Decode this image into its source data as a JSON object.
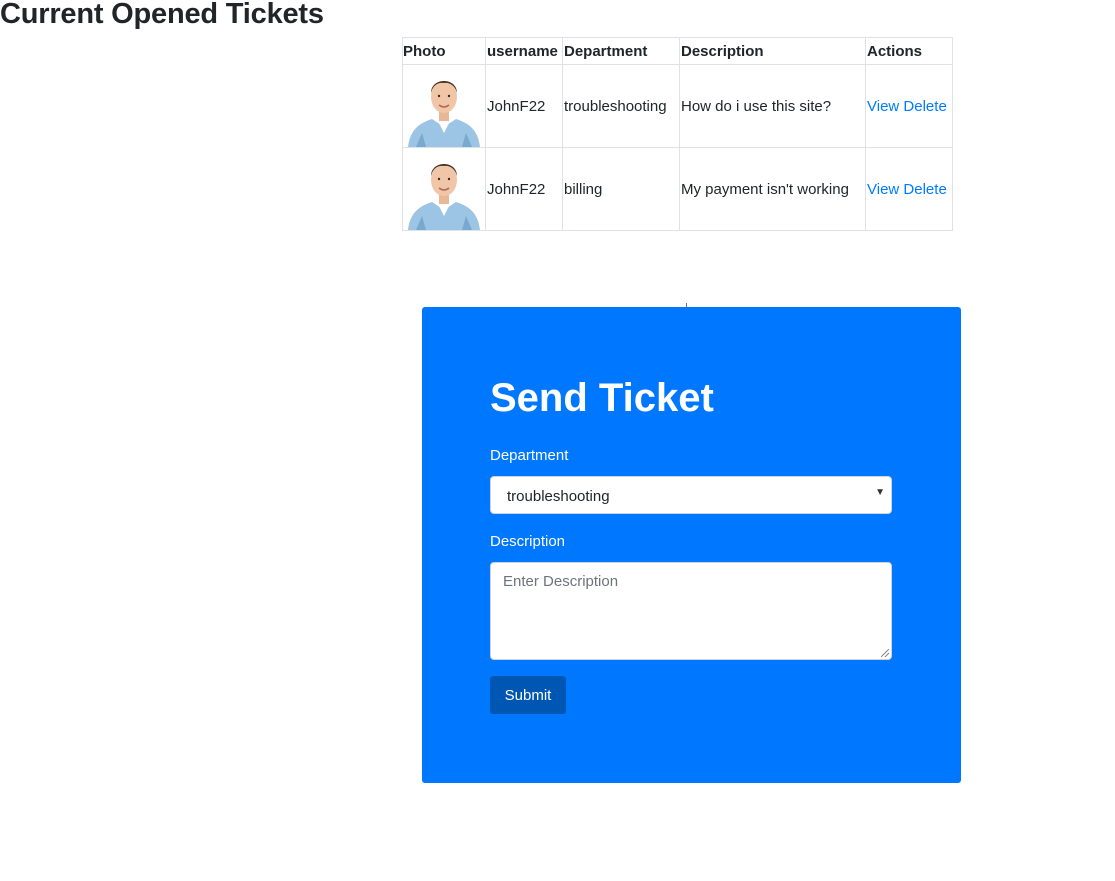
{
  "page": {
    "title": "Current Opened Tickets"
  },
  "table": {
    "headers": {
      "photo": "Photo",
      "username": "username",
      "department": "Department",
      "description": "Description",
      "actions": "Actions"
    },
    "rows": [
      {
        "username": "JohnF22",
        "department": "troubleshooting",
        "description": "How do i use this site?",
        "view_label": "View",
        "delete_label": "Delete"
      },
      {
        "username": "JohnF22",
        "department": "billing",
        "description": "My payment isn't working",
        "view_label": "View",
        "delete_label": "Delete"
      }
    ]
  },
  "form": {
    "title": "Send Ticket",
    "department_label": "Department",
    "department_value": "troubleshooting",
    "description_label": "Description",
    "description_placeholder": "Enter Description",
    "submit_label": "Submit"
  },
  "colors": {
    "panel": "#0077ff",
    "submit": "#0056b3",
    "link": "#007bff"
  }
}
